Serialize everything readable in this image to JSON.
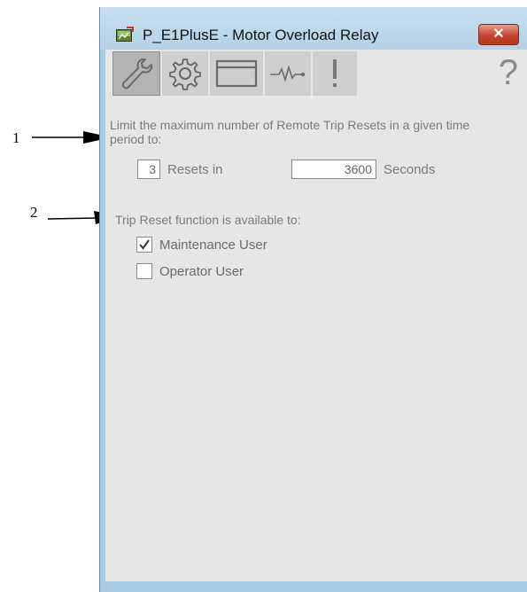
{
  "callouts": [
    {
      "number": "1"
    },
    {
      "number": "2"
    }
  ],
  "window": {
    "title": "P_E1PlusE - Motor Overload Relay",
    "close_glyph": "✕",
    "app_icon": "faceplate-icon"
  },
  "toolbar": {
    "tabs": [
      {
        "icon": "wrench-icon",
        "active": true
      },
      {
        "icon": "gear-icon",
        "active": false
      },
      {
        "icon": "window-icon",
        "active": false
      },
      {
        "icon": "trend-icon",
        "active": false
      },
      {
        "icon": "alarm-icon",
        "active": false
      }
    ],
    "help_glyph": "?"
  },
  "reset_limit": {
    "description": "Limit the maximum number of Remote Trip Resets in a given time period to:",
    "count_value": "3",
    "count_label": "Resets in",
    "seconds_value": "3600",
    "seconds_label": "Seconds"
  },
  "trip_reset_access": {
    "heading": "Trip Reset function is available to:",
    "options": [
      {
        "label": "Maintenance User",
        "checked": true
      },
      {
        "label": "Operator User",
        "checked": false
      }
    ]
  },
  "colors": {
    "window_frame": "#a9cbe3",
    "panel_bg": "#e6e6e6",
    "text_gray": "#7a7a7a",
    "close_red": "#c7432e"
  }
}
